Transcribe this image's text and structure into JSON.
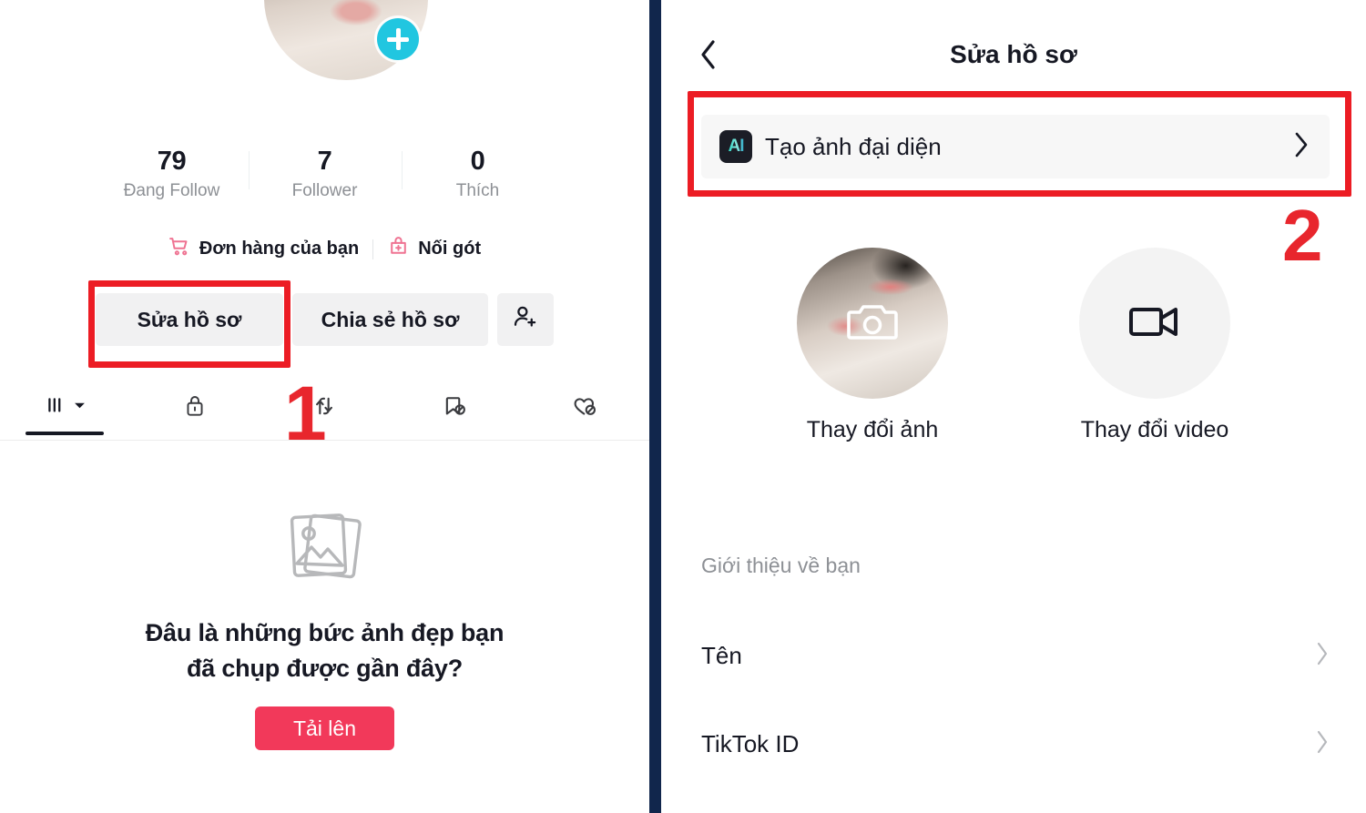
{
  "profile": {
    "avatar_alt": "cat-profile-photo",
    "add_badge_icon": "plus-icon",
    "stats": [
      {
        "value": "79",
        "label": "Đang Follow"
      },
      {
        "value": "7",
        "label": "Follower"
      },
      {
        "value": "0",
        "label": "Thích"
      }
    ],
    "quick_links": [
      {
        "icon": "shopping-cart-icon",
        "label": "Đơn hàng của bạn"
      },
      {
        "icon": "add-anchor-icon",
        "label": "Nối gót"
      }
    ],
    "actions": {
      "edit_profile": "Sửa hồ sơ",
      "share_profile": "Chia sẻ hồ sơ",
      "add_friend_icon": "add-person-icon"
    },
    "tabs": [
      {
        "icon": "posts-grid-icon",
        "name": "posts",
        "has_dropdown": true,
        "active": true
      },
      {
        "icon": "lock-icon",
        "name": "private",
        "has_dropdown": false,
        "active": false
      },
      {
        "icon": "repost-icon",
        "name": "reposts",
        "has_dropdown": false,
        "active": false
      },
      {
        "icon": "bookmark-off-icon",
        "name": "favorites",
        "has_dropdown": false,
        "active": false
      },
      {
        "icon": "heart-off-icon",
        "name": "liked",
        "has_dropdown": false,
        "active": false
      }
    ],
    "empty_state": {
      "icon": "photo-stack-icon",
      "title_line1": "Đâu là những bức ảnh đẹp bạn",
      "title_line2": "đã chụp được gần đây?",
      "button_label": "Tải lên"
    }
  },
  "edit_profile": {
    "back_icon": "chevron-left-icon",
    "title": "Sửa hồ sơ",
    "ai_row": {
      "badge_text": "AI",
      "badge_icon": "ai-badge-icon",
      "label": "Tạo ảnh đại diện",
      "chevron": "›"
    },
    "media": [
      {
        "icon": "camera-icon",
        "label": "Thay đổi ảnh",
        "name": "change-photo"
      },
      {
        "icon": "video-cam-icon",
        "label": "Thay đổi video",
        "name": "change-video"
      }
    ],
    "section_label": "Giới thiệu về bạn",
    "rows": [
      {
        "label": "Tên",
        "chevron": "›",
        "name": "name"
      },
      {
        "label": "TikTok ID",
        "chevron": "›",
        "name": "tiktok-id"
      }
    ]
  },
  "annotations": {
    "step_one": "1",
    "step_two": "2",
    "highlight_color": "#ec1c24"
  },
  "colors": {
    "accent_red": "#f2395a",
    "divider_navy": "#11264c",
    "badge_cyan": "#21c6e0",
    "pink_link": "#f06b8a",
    "grey_button": "#f1f1f2",
    "annotation_red": "#e8262d"
  }
}
